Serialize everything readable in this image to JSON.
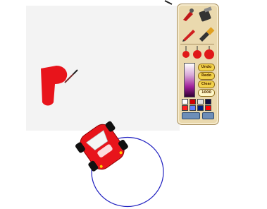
{
  "toolbox": {
    "buttons": {
      "undo_label": "Undo",
      "redo_label": "Redo",
      "clear_label": "Clear",
      "size_label": "1000"
    },
    "palette": [
      "#ffffff",
      "#d00000",
      "#e0e0e0",
      "#101040",
      "#ff2020",
      "#6080ff",
      "#002080",
      "#ff0000"
    ],
    "gradient_colors": [
      "#ffffff",
      "#a0209a",
      "#300030"
    ]
  },
  "colors": {
    "car_body": "#e8141b",
    "paint_stroke": "#e8141b",
    "circle_outline": "#2020c0"
  }
}
